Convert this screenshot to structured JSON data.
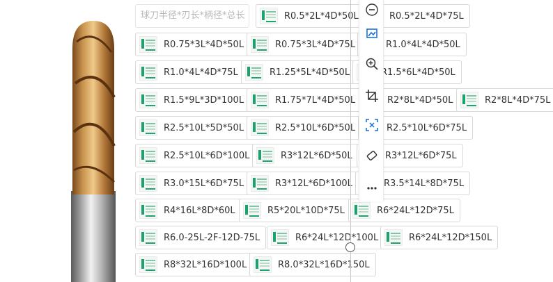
{
  "filter": {
    "placeholder": "球刀半径*刃长*柄径*总长"
  },
  "options": [
    {
      "label": "R0.5*2L*4D*50L"
    },
    {
      "label": "R0.5*2L*4D*75L"
    },
    {
      "label": "R0.75*3L*4D*50L"
    },
    {
      "label": "R0.75*3L*4D*75L"
    },
    {
      "label": "R1.0*4L*4D*50L"
    },
    {
      "label": "R1.0*4L*4D*75L"
    },
    {
      "label": "R1.25*5L*4D*50L"
    },
    {
      "label": "R1.5*6L*4D*50L"
    },
    {
      "label": "R1.5*9L*3D*100L"
    },
    {
      "label": "R1.75*7L*4D*50L"
    },
    {
      "label": "R2*8L*4D*50L"
    },
    {
      "label": "R2*8L*4D*75L"
    },
    {
      "label": "R2.5*10L*5D*50L"
    },
    {
      "label": "R2.5*10L*6D*50L"
    },
    {
      "label": "R2.5*10L*6D*75L"
    },
    {
      "label": "R2.5*10L*6D*100L"
    },
    {
      "label": "R3*12L*6D*50L"
    },
    {
      "label": "R3*12L*6D*75L"
    },
    {
      "label": "R3.0*15L*6D*75L"
    },
    {
      "label": "R3*12L*6D*100L"
    },
    {
      "label": "R3.5*14L*8D*75L"
    },
    {
      "label": "R4*16L*8D*60L"
    },
    {
      "label": "R5*20L*10D*75L"
    },
    {
      "label": "R6*24L*12D*75L"
    },
    {
      "label": "R6.0-25L-2F-12D-75L"
    },
    {
      "label": "R6*24L*12D*100L"
    },
    {
      "label": "R6*24L*12D*150L"
    },
    {
      "label": "R8*32L*16D*100L"
    },
    {
      "label": "R8.0*32L*16D*150L"
    }
  ],
  "toolbar": {
    "tools": [
      {
        "icon": "minus-icon"
      },
      {
        "icon": "image-icon"
      },
      {
        "icon": "zoom-in-icon"
      },
      {
        "icon": "crop-icon"
      },
      {
        "icon": "fit-screen-icon"
      },
      {
        "icon": "eraser-icon"
      },
      {
        "icon": "more-icon"
      }
    ]
  },
  "colors": {
    "tool_green": "#1aa36b",
    "toolbar_blue": "#1f6fd1",
    "coating_gold": "#c8944f"
  }
}
